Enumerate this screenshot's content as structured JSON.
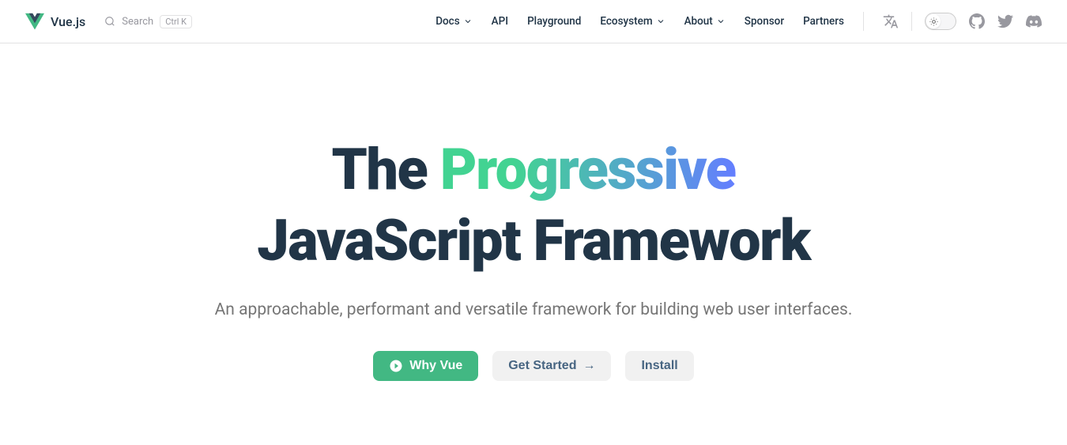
{
  "brand": {
    "name": "Vue.js"
  },
  "search": {
    "placeholder": "Search",
    "shortcut": "Ctrl K"
  },
  "nav": {
    "docs": "Docs",
    "api": "API",
    "playground": "Playground",
    "ecosystem": "Ecosystem",
    "about": "About",
    "sponsor": "Sponsor",
    "partners": "Partners"
  },
  "hero": {
    "title_prefix": "The",
    "title_highlight": "Progressive",
    "title_line2": "JavaScript Framework",
    "subtitle": "An approachable, performant and versatile framework for building web user interfaces.",
    "btn_why": "Why Vue",
    "btn_getstarted": "Get Started",
    "btn_getstarted_arrow": "→",
    "btn_install": "Install"
  },
  "colors": {
    "primary": "#42b883",
    "gradient_from": "#42d392",
    "gradient_to": "#647eff",
    "text": "#213547",
    "muted": "#767676"
  }
}
